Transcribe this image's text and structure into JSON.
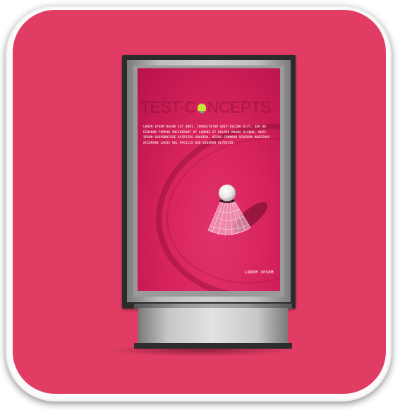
{
  "poster": {
    "logo_left": "TEST-C",
    "logo_right": "NCEPTS",
    "body_text": "LOREM IPSUM DOLOR SIT AMET, CONSECTETUR ADIP-ISCING ELIT, SED DO EIUSMOD TEMPOR INCIDIDUNT UT LABORE ET DOLORE MAGNA ALIQUA. DUIS IPSUM SUSPENDISSE ULTRICES GRAVIDA. RISUS COMMODO VIVERRA MAECENAS ACCUMSAN LACUS VEL FACILIS SED EIUSMOD ULTRICES.",
    "caption": "LOREM IPSUM"
  },
  "colors": {
    "tile": "#e13d64",
    "poster": "#d8245c",
    "logo_bulb": "#c8e63a"
  },
  "icons": {
    "logo_bulb": "lightbulb-icon",
    "shuttlecock": "shuttlecock-icon"
  }
}
